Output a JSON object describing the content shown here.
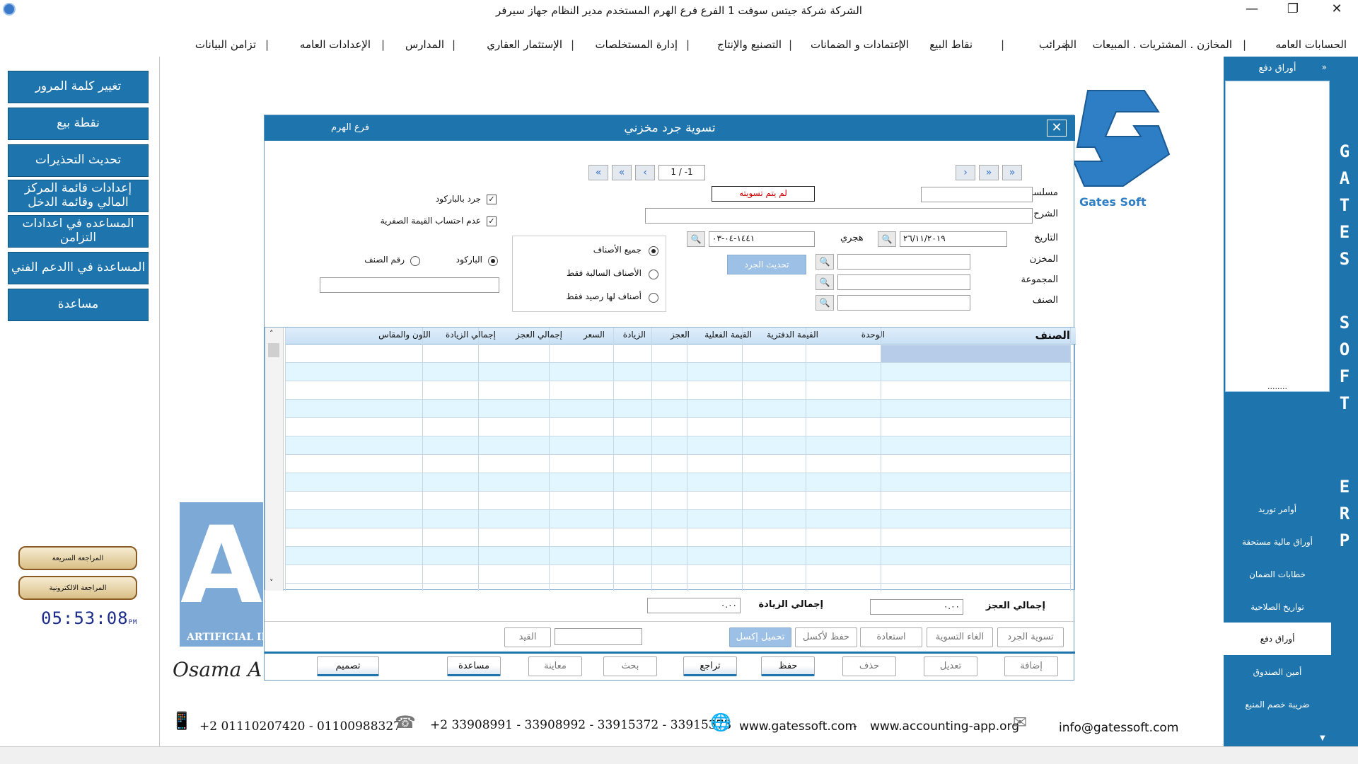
{
  "window": {
    "title": "الشركة شركة جيتس سوفت 1   الفرع فرع الهرم   المستخدم مدير النظام  جهاز سيرفر",
    "minimize": "—",
    "restore": "❐",
    "close": "✕"
  },
  "menu": [
    "الحسابات العامه",
    "المخازن . المشتريات . المبيعات",
    "الضرائب",
    "نقاط البيع",
    "الاعتمادات و الضمانات",
    "التصنيع والإنتاج",
    "إدارة المستخلصات",
    "الإستثمار العقاري",
    "المدارس",
    "الإعدادات العامه",
    "تزامن البيانات"
  ],
  "left_buttons": [
    "تغيير كلمة المرور",
    "نقطة بيع",
    "تحديث التحذيرات",
    "إعدادات قائمة المركز المالي وقائمة الدخل",
    "المساعده في اعدادات التزامن",
    "المساعدة في االدعم الفني",
    "مساعدة"
  ],
  "review_buttons": [
    "المراجعة السريعة",
    "المراجعة الالكترونية"
  ],
  "clock": {
    "time": "05:53:08",
    "ampm": "PM"
  },
  "brand": {
    "logo_text": "Gates Soft",
    "vertical_letters": [
      "G",
      "A",
      "T",
      "E",
      "S",
      "S",
      "O",
      "F",
      "T",
      "E",
      "R",
      "P"
    ],
    "watermark_letter": "A",
    "watermark_text": "ARTIFICIAL IN",
    "signature": "Osama Ahm"
  },
  "right_panel": {
    "header": "أوراق دفع",
    "collapse_icon": "chevron-right-icon",
    "dots": "........",
    "items": [
      {
        "label": "أوامر توريد",
        "active": false
      },
      {
        "label": "أوراق مالية مستحقة",
        "active": false
      },
      {
        "label": "خطابات الضمان",
        "active": false
      },
      {
        "label": "تواريخ الصلاحية",
        "active": false
      },
      {
        "label": "أوراق دفع",
        "active": true
      },
      {
        "label": "أمين الصندوق",
        "active": false
      },
      {
        "label": "ضريبة خصم المنبع",
        "active": false
      }
    ]
  },
  "dialog": {
    "title": "تسوية جرد مخزني",
    "branch": "فرع الهرم",
    "close": "✕",
    "nav": {
      "first": "«",
      "prev": "‹",
      "record": "1 / -1",
      "next": "›",
      "last": "»"
    },
    "fields": {
      "serial_label": "مسلسل",
      "serial_value": "",
      "status_value": "لم يتم تسويته",
      "description_label": "الشرح",
      "description_value": "",
      "date_label": "التاريخ",
      "date_value": "٢٦/١١/٢٠١٩",
      "hijri_label": "هجري",
      "hijri_value": "١٤٤١-٠٤-٠٣",
      "store_label": "المخزن",
      "group_label": "المجموعة",
      "item_label": "الصنف",
      "update_button": "تحديث الجرد"
    },
    "options": {
      "barcode_count": {
        "label": "جرد بالباركود",
        "checked": true
      },
      "zero_value": {
        "label": "عدم احتساب القيمة الصفرية",
        "checked": true
      },
      "scope": [
        {
          "label": "جميع الأصناف",
          "checked": true
        },
        {
          "label": "الأصناف السالبة فقط",
          "checked": false
        },
        {
          "label": "أصناف لها رصيد فقط",
          "checked": false
        }
      ],
      "search_by": [
        {
          "label": "الباركود",
          "checked": true
        },
        {
          "label": "رقم الصنف",
          "checked": false
        }
      ]
    },
    "grid": {
      "columns": [
        "الصنف",
        "الوحدة",
        "القيمة الدفترية",
        "القيمة الفعلية",
        "العجز",
        "الزيادة",
        "السعر",
        "إجمالي العجز",
        "إجمالي الزيادة",
        "اللون والمقاس"
      ],
      "rows": []
    },
    "totals": {
      "deficit_label": "إجمالي العجز",
      "deficit_value": "٠.٠٠",
      "surplus_label": "إجمالي الزيادة",
      "surplus_value": "٠.٠٠"
    },
    "action_row_1": {
      "settle": "تسوية الجرد",
      "cancel_settle": "الغاء التسوية",
      "restore": "استعادة",
      "save_excel": "حفظ لأكسل",
      "load_excel": "تحميل إكسل",
      "entry": "القيد"
    },
    "action_row_2": {
      "add": "إضافة",
      "edit": "تعديل",
      "delete": "حذف",
      "save": "حفظ",
      "undo": "تراجع",
      "search": "بحث",
      "preview": "معاينة",
      "help": "مساعدة",
      "design": "تصميم"
    }
  },
  "footer": {
    "mobile": "+2 01110207420 - 01100988327",
    "phones": "+2 33908991 - 33908992 - 33915372 - 33915373",
    "site1": "www.gatessoft.com",
    "dash": "-",
    "site2": "www.accounting-app.org",
    "email": "info@gatessoft.com"
  },
  "colors": {
    "primary": "#1e74ad",
    "grid_row": "#e2f6ff",
    "grid_header": "#c9e1f5"
  }
}
